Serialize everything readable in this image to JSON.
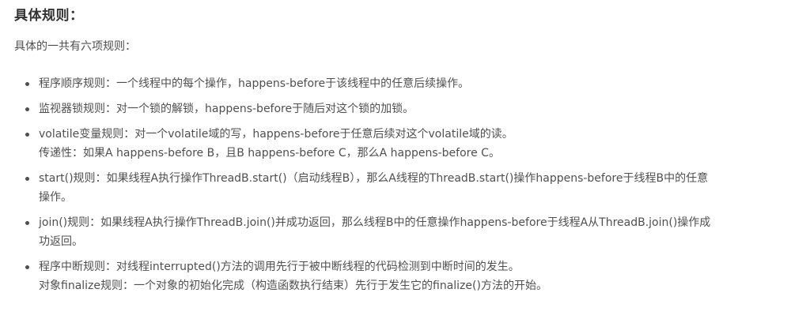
{
  "heading": "具体规则：",
  "intro": "具体的一共有六项规则：",
  "rules": [
    {
      "lines": [
        "程序顺序规则：一个线程中的每个操作，happens-before于该线程中的任意后续操作。"
      ]
    },
    {
      "lines": [
        "监视器锁规则：对一个锁的解锁，happens-before于随后对这个锁的加锁。"
      ]
    },
    {
      "lines": [
        "volatile变量规则：对一个volatile域的写，happens-before于任意后续对这个volatile域的读。",
        "传递性：如果A happens-before B，且B happens-before C，那么A happens-before C。"
      ]
    },
    {
      "lines": [
        "start()规则：如果线程A执行操作ThreadB.start()（启动线程B），那么A线程的ThreadB.start()操作happens-before于线程B中的任意",
        "操作。"
      ]
    },
    {
      "lines": [
        "join()规则：如果线程A执行操作ThreadB.join()并成功返回，那么线程B中的任意操作happens-before于线程A从ThreadB.join()操作成",
        "功返回。"
      ]
    },
    {
      "lines": [
        "程序中断规则：对线程interrupted()方法的调用先行于被中断线程的代码检测到中断时间的发生。",
        "对象finalize规则：一个对象的初始化完成（构造函数执行结束）先行于发生它的finalize()方法的开始。"
      ]
    }
  ]
}
